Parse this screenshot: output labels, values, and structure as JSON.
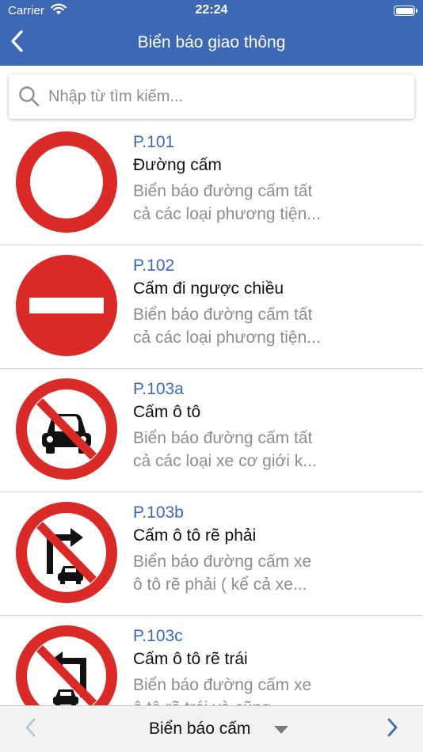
{
  "status_bar": {
    "carrier": "Carrier",
    "time": "22:24"
  },
  "nav": {
    "title": "Biển báo giao thông",
    "back_icon": "chevron-left-icon"
  },
  "search": {
    "placeholder": "Nhập từ tìm kiếm...",
    "value": "",
    "icon": "search-icon"
  },
  "colors": {
    "header": "#3d68b5",
    "code": "#3d68b5",
    "sign_red": "#d92a27",
    "description": "#8d8d8d"
  },
  "items": [
    {
      "code": "P.101",
      "name": "Đường cấm",
      "desc_line1": "Biển báo đường cấm tất",
      "desc_line2": "cả các loại phương tiện...",
      "icon": "no-entry-all-vehicles-sign"
    },
    {
      "code": "P.102",
      "name": "Cấm đi ngược chiều",
      "desc_line1": "Biển báo đường cấm tất",
      "desc_line2": "cả các loại phương tiện...",
      "icon": "no-entry-sign"
    },
    {
      "code": "P.103a",
      "name": "Cấm ô tô",
      "desc_line1": "Biển báo đường cấm tất",
      "desc_line2": "cả các loại xe cơ giới k...",
      "icon": "no-cars-sign"
    },
    {
      "code": "P.103b",
      "name": "Cấm ô tô rẽ phải",
      "desc_line1": "Biển báo đường cấm xe",
      "desc_line2": "ô tô rẽ phải ( kể cả xe...",
      "icon": "no-car-right-turn-sign"
    },
    {
      "code": "P.103c",
      "name": "Cấm ô tô rẽ trái",
      "desc_line1": "Biển báo đường cấm xe",
      "desc_line2": "ô tô rẽ trái và cũng...",
      "icon": "no-car-left-turn-sign"
    }
  ],
  "toolbar": {
    "category": "Biển báo cấm",
    "prev_icon": "chevron-left-icon",
    "next_icon": "chevron-right-icon",
    "dropdown_icon": "triangle-down-icon"
  }
}
